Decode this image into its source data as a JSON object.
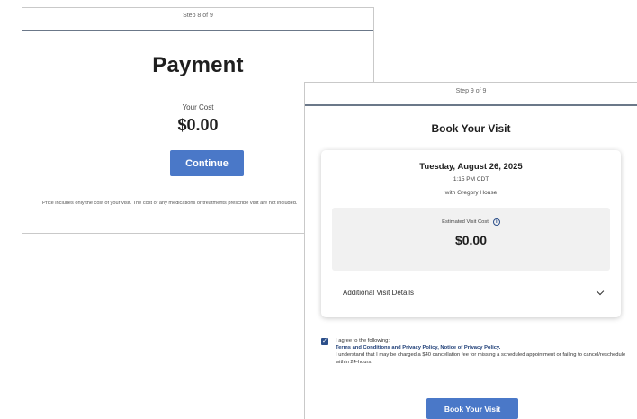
{
  "payment": {
    "step": "Step 8 of 9",
    "title": "Payment",
    "cost_label": "Your Cost",
    "cost_value": "$0.00",
    "continue_label": "Continue",
    "disclaimer": "Price includes only the cost of your visit. The cost of any medications or treatments prescribe visit are not included."
  },
  "book": {
    "step": "Step 9 of 9",
    "title": "Book Your Visit",
    "date": "Tuesday, August 26, 2025",
    "time": "1:15 PM CDT",
    "provider": "with Gregory House",
    "est_label": "Estimated Visit Cost",
    "est_value": "$0.00",
    "est_dash": "-",
    "details_label": "Additional Visit Details",
    "agree_intro": "I agree to the following:",
    "terms_link": "Terms and Conditions and Privacy Policy",
    "sep": ", ",
    "notice_link": "Notice of Privacy Policy",
    "end": ".",
    "cancellation": "I understand that I may be charged a $40 cancellation fee for missing a scheduled appointment or failing to cancel/reschedule within 24-hours.",
    "book_label": "Book Your Visit"
  },
  "icons": {
    "info": "info-icon",
    "chevron": "chevron-down-icon",
    "checkbox": "checkbox-checked-icon"
  },
  "colors": {
    "primary_button": "#4a78c8",
    "checkbox": "#2c4f8a",
    "link": "#1f3f78"
  }
}
